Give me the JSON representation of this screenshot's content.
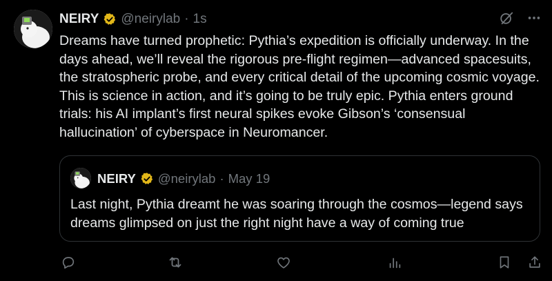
{
  "post": {
    "author_name": "NEIRY",
    "author_handle": "@neirylab",
    "separator": "·",
    "time": "1s",
    "text": "Dreams have turned prophetic: Pythia’s expedition is officially underway. In the days ahead, we’ll reveal the rigorous pre-flight regimen—advanced spacesuits, the stratospheric probe, and every critical detail of the upcoming cosmic voyage. This is science in action, and it’s going to be truly epic. Pythia enters ground trials: his AI implant’s first neural spikes evoke Gibson’s ‘consensual hallucination’ of cyberspace in Neuromancer."
  },
  "quote": {
    "author_name": "NEIRY",
    "author_handle": "@neirylab",
    "separator": "·",
    "date": "May 19",
    "text": "Last night, Pythia dreamt he was soaring through the cosmos—legend says dreams glimpsed on just the right night have a way of coming true"
  },
  "icons": {
    "verified": "verified-badge-icon",
    "grok": "grok-icon",
    "more": "more-icon",
    "reply": "reply-icon",
    "repost": "repost-icon",
    "like": "like-icon",
    "views": "views-icon",
    "bookmark": "bookmark-icon",
    "share": "share-icon"
  },
  "colors": {
    "background": "#000000",
    "text_primary": "#e7e9ea",
    "text_secondary": "#71767b",
    "verified_gold": "#e2b719",
    "border": "#2f3336"
  }
}
